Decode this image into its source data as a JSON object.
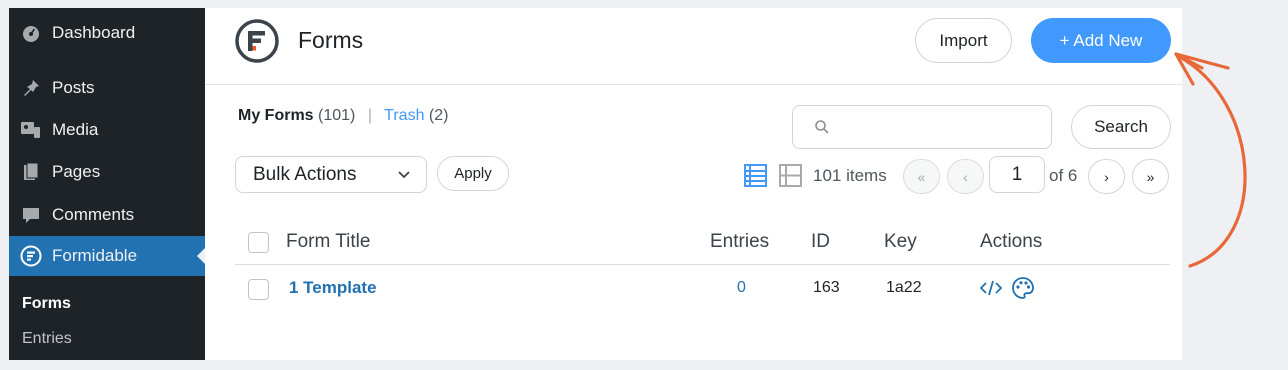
{
  "sidebar": {
    "items": [
      {
        "label": "Dashboard",
        "icon": "dashboard-icon"
      },
      {
        "label": "Posts",
        "icon": "pin-icon"
      },
      {
        "label": "Media",
        "icon": "media-icon"
      },
      {
        "label": "Pages",
        "icon": "pages-icon"
      },
      {
        "label": "Comments",
        "icon": "comment-icon"
      },
      {
        "label": "Formidable",
        "icon": "formidable-icon",
        "active": true
      }
    ],
    "submenu": [
      {
        "label": "Forms",
        "current": true
      },
      {
        "label": "Entries"
      }
    ]
  },
  "header": {
    "title": "Forms",
    "import_label": "Import",
    "add_new_label": "+ Add New",
    "accent": "#4199fd"
  },
  "views": {
    "my_forms_label": "My Forms",
    "my_forms_count": "(101)",
    "separator": "|",
    "trash_label": "Trash",
    "trash_count": "(2)"
  },
  "search": {
    "placeholder": "",
    "button_label": "Search"
  },
  "bulk": {
    "selected": "Bulk Actions",
    "apply_label": "Apply"
  },
  "pagination": {
    "items_label": "101 items",
    "first": "«",
    "prev": "‹",
    "current_page": "1",
    "total_label": "of 6",
    "next": "›",
    "last": "»"
  },
  "table": {
    "columns": [
      "Form Title",
      "Entries",
      "ID",
      "Key",
      "Actions"
    ],
    "rows": [
      {
        "title": "1 Template",
        "entries": "0",
        "id": "163",
        "key": "1a22",
        "actions": [
          "embed-code-icon",
          "style-palette-icon"
        ]
      }
    ]
  },
  "annotation": {
    "arrow_color": "#e8683a"
  }
}
